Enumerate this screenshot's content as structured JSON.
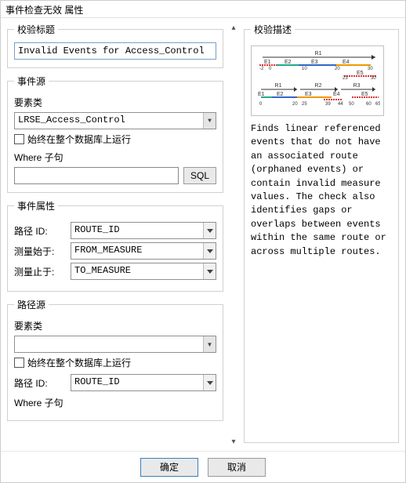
{
  "window": {
    "title": "事件检查无效 属性"
  },
  "left": {
    "group_title": {
      "legend": "校验标题",
      "value": "Invalid Events for Access_Control"
    },
    "group_source": {
      "legend": "事件源",
      "element_class_label": "要素类",
      "element_class_value": "LRSE_Access_Control",
      "always_run_label": "始终在整个数据库上运行",
      "always_run_checked": false,
      "where_label": "Where 子句",
      "where_value": "",
      "sql_btn": "SQL"
    },
    "group_attrs": {
      "legend": "事件属性",
      "route_id_label": "路径 ID:",
      "route_id_value": "ROUTE_ID",
      "from_label": "测量始于:",
      "from_value": "FROM_MEASURE",
      "to_label": "测量止于:",
      "to_value": "TO_MEASURE"
    },
    "group_route_source": {
      "legend": "路径源",
      "element_class_label": "要素类",
      "element_class_value": "",
      "always_run_label": "始终在整个数据库上运行",
      "always_run_checked": false,
      "route_id_label": "路径 ID:",
      "route_id_value": "ROUTE_ID",
      "where_label": "Where 子句"
    }
  },
  "right": {
    "legend": "校验描述",
    "text": "Finds linear referenced events that do not have an associated route (orphaned events) or contain invalid measure values. The check also identifies gaps or overlaps between events within the same route or across multiple routes."
  },
  "footer": {
    "ok": "确定",
    "cancel": "取消"
  },
  "chart_data": [
    {
      "type": "linear-referencing-diagram",
      "routes": [
        {
          "name": "R1",
          "axis": {
            "min": -2,
            "max": 30,
            "ticks": [
              -2,
              0,
              10,
              20,
              30
            ]
          }
        }
      ],
      "events": [
        {
          "name": "E1",
          "from": -2,
          "to": 4,
          "color": "red-dashed"
        },
        {
          "name": "E2",
          "from": 4,
          "to": 10,
          "color": "green"
        },
        {
          "name": "E3",
          "from": 10,
          "to": 21,
          "color": "blue"
        },
        {
          "name": "E4",
          "from": 21,
          "to": 30,
          "color": "orange"
        },
        {
          "name": "E5",
          "from": 16,
          "to": 31,
          "color": "red-dashed"
        }
      ],
      "sub_axis": {
        "ticks": [
          23,
          30
        ]
      }
    },
    {
      "type": "linear-referencing-diagram",
      "routes": [
        {
          "name": "R1",
          "axis": {
            "min": 0,
            "max": 20
          }
        },
        {
          "name": "R2",
          "axis": {
            "min": 20,
            "max": 40
          }
        },
        {
          "name": "R3",
          "axis": {
            "min": 40,
            "max": 60
          }
        }
      ],
      "events": [
        {
          "name": "E1",
          "from": 0,
          "to": 6,
          "color": "green"
        },
        {
          "name": "E2",
          "from": 6,
          "to": 20,
          "color": "blue"
        },
        {
          "name": "E3",
          "from": 20,
          "to": 39,
          "color": "orange"
        },
        {
          "name": "E4",
          "from": 35,
          "to": 44,
          "color": "red-dashed"
        },
        {
          "name": "E5",
          "from": 50,
          "to": 65,
          "color": "red-dashed"
        }
      ],
      "bottom_axis": {
        "ticks": [
          0,
          20,
          25,
          39,
          44,
          50,
          60,
          65
        ]
      }
    }
  ]
}
